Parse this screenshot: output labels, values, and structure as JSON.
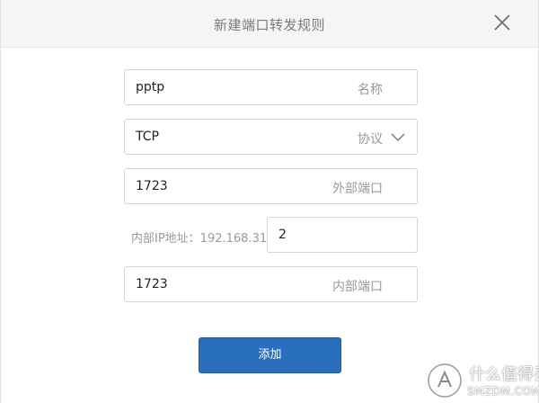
{
  "dialog": {
    "title": "新建端口转发规则",
    "close_icon": "close-icon"
  },
  "form": {
    "name": {
      "value": "pptp",
      "suffix": "名称"
    },
    "protocol": {
      "value": "TCP",
      "suffix": "协议",
      "icon": "chevron-down-icon"
    },
    "external_port": {
      "value": "1723",
      "suffix": "外部端口"
    },
    "internal_ip": {
      "label": "内部IP地址：192.168.31.",
      "value": "2"
    },
    "internal_port": {
      "value": "1723",
      "suffix": "内部端口"
    }
  },
  "actions": {
    "add_label": "添加",
    "add_color": "#2a6fbe"
  },
  "watermark": {
    "cn": "什么值得买",
    "en": "SMZDM.COM"
  }
}
